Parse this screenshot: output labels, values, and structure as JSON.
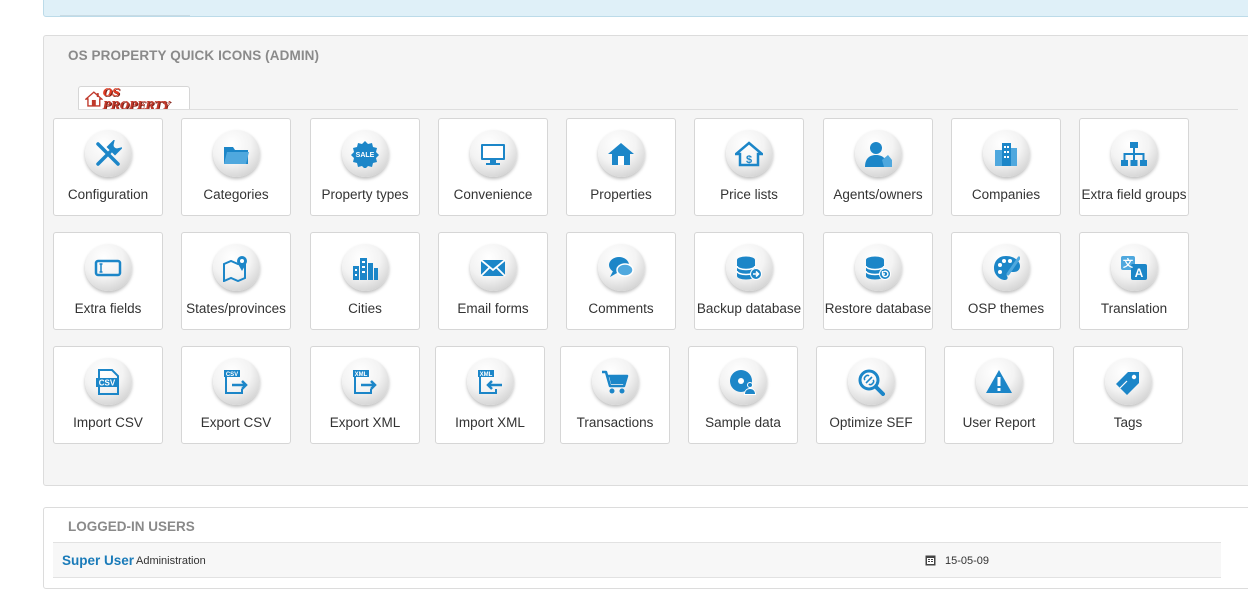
{
  "quick_icons": {
    "title": "OS PROPERTY QUICK ICONS (ADMIN)",
    "logo": {
      "os": "OS ",
      "text": "PROPERTY"
    },
    "rows": [
      [
        {
          "label": "Configuration",
          "icon": "tools-icon"
        },
        {
          "label": "Categories",
          "icon": "folder-icon"
        },
        {
          "label": "Property types",
          "icon": "sale-badge-icon"
        },
        {
          "label": "Convenience",
          "icon": "monitor-icon"
        },
        {
          "label": "Properties",
          "icon": "house-icon"
        },
        {
          "label": "Price lists",
          "icon": "house-dollar-icon"
        },
        {
          "label": "Agents/owners",
          "icon": "agent-icon"
        },
        {
          "label": "Companies",
          "icon": "buildings-icon"
        },
        {
          "label": "Extra field groups",
          "icon": "sitemap-icon"
        }
      ],
      [
        {
          "label": "Extra fields",
          "icon": "textfield-icon"
        },
        {
          "label": "States/provinces",
          "icon": "map-pin-icon"
        },
        {
          "label": "Cities",
          "icon": "city-icon"
        },
        {
          "label": "Email forms",
          "icon": "envelope-icon"
        },
        {
          "label": "Comments",
          "icon": "chat-bubbles-icon"
        },
        {
          "label": "Backup database",
          "icon": "database-export-icon"
        },
        {
          "label": "Restore database",
          "icon": "database-restore-icon"
        },
        {
          "label": "OSP themes",
          "icon": "palette-icon"
        },
        {
          "label": "Translation",
          "icon": "translate-icon"
        }
      ],
      [
        {
          "label": "Import CSV",
          "icon": "csv-file-icon"
        },
        {
          "label": "Export CSV",
          "icon": "csv-export-icon"
        },
        {
          "label": "Export XML",
          "icon": "xml-export-icon"
        },
        {
          "label": "Import XML",
          "icon": "xml-import-icon"
        },
        {
          "label": "Transactions",
          "icon": "cart-icon"
        },
        {
          "label": "Sample data",
          "icon": "disc-user-icon"
        },
        {
          "label": "Optimize SEF",
          "icon": "magnifier-link-icon"
        },
        {
          "label": "User Report",
          "icon": "warning-icon"
        },
        {
          "label": "Tags",
          "icon": "tag-icon"
        }
      ]
    ]
  },
  "logged_in": {
    "title": "LOGGED-IN USERS",
    "user_name": "Super User",
    "user_role": "Administration",
    "date": "15-05-09"
  },
  "colors": {
    "icon_blue": "#1c86c8",
    "link_blue": "#1a7bb9"
  }
}
